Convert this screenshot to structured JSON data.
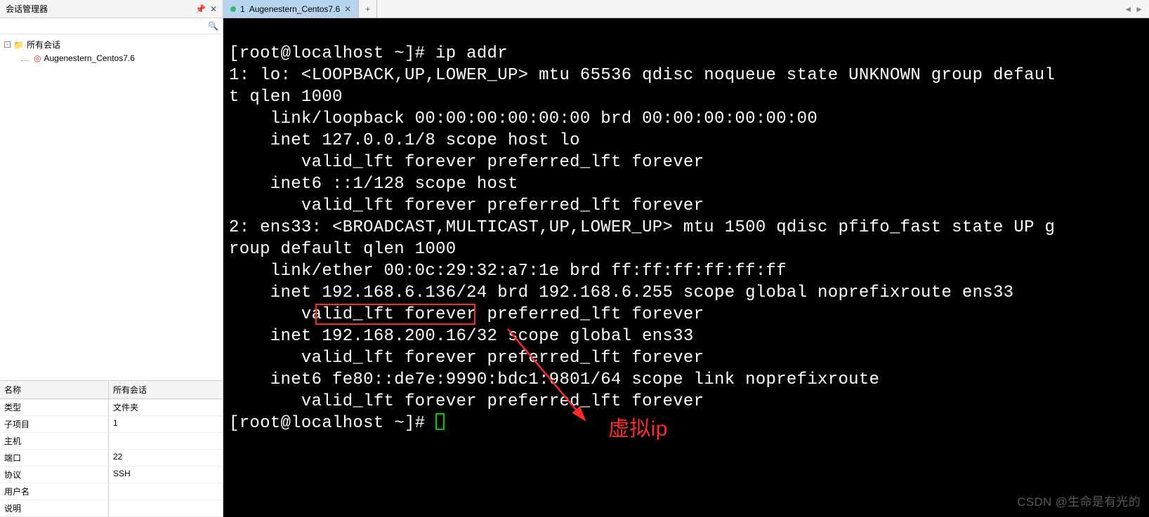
{
  "sidebar": {
    "title": "会话管理器",
    "pin_icon": "pin-icon",
    "close_icon": "close-icon",
    "search_placeholder": "",
    "root_label": "所有会话",
    "session_label": "Augenestern_Centos7.6"
  },
  "props": {
    "header_key": "名称",
    "header_val": "所有会话",
    "rows": [
      {
        "k": "类型",
        "v": "文件夹"
      },
      {
        "k": "子项目",
        "v": "1"
      },
      {
        "k": "主机",
        "v": ""
      },
      {
        "k": "端口",
        "v": "22"
      },
      {
        "k": "协议",
        "v": "SSH"
      },
      {
        "k": "用户名",
        "v": ""
      },
      {
        "k": "说明",
        "v": ""
      }
    ]
  },
  "tabs": {
    "active_index": "1",
    "active_label": "Augenestern_Centos7.6",
    "add": "+"
  },
  "terminal": {
    "prompt1": "[root@localhost ~]# ",
    "cmd1": "ip addr",
    "line01": "1: lo: <LOOPBACK,UP,LOWER_UP> mtu 65536 qdisc noqueue state UNKNOWN group defaul",
    "line02": "t qlen 1000",
    "line03": "    link/loopback 00:00:00:00:00:00 brd 00:00:00:00:00:00",
    "line04": "    inet 127.0.0.1/8 scope host lo",
    "line05": "       valid_lft forever preferred_lft forever",
    "line06": "    inet6 ::1/128 scope host ",
    "line07": "       valid_lft forever preferred_lft forever",
    "line08": "2: ens33: <BROADCAST,MULTICAST,UP,LOWER_UP> mtu 1500 qdisc pfifo_fast state UP g",
    "line09": "roup default qlen 1000",
    "line10": "    link/ether 00:0c:29:32:a7:1e brd ff:ff:ff:ff:ff:ff",
    "line11": "    inet 192.168.6.136/24 brd 192.168.6.255 scope global noprefixroute ens33",
    "line12": "       valid_lft forever preferred_lft forever",
    "line13": "    inet 192.168.200.16/32 scope global ens33",
    "line14": "       valid_lft forever preferred_lft forever",
    "line15": "    inet6 fe80::de7e:9990:bdc1:9801/64 scope link noprefixroute ",
    "line16": "       valid_lft forever preferred_lft forever",
    "prompt2": "[root@localhost ~]# "
  },
  "annotation": {
    "label": "虚拟ip",
    "boxed_ip": "192.168.200.16"
  },
  "watermark": "CSDN @生命是有光的"
}
